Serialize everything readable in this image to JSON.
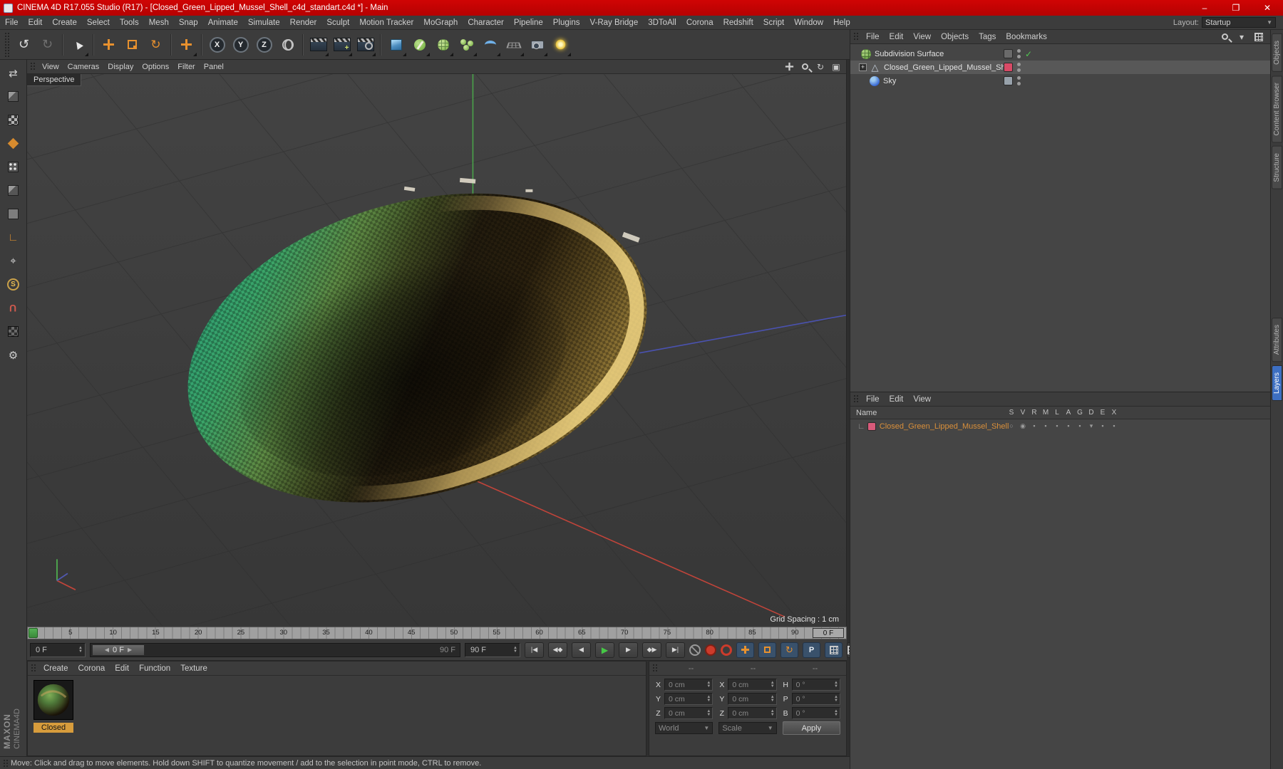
{
  "window": {
    "title": "CINEMA 4D R17.055 Studio (R17) - [Closed_Green_Lipped_Mussel_Shell_c4d_standart.c4d *] - Main",
    "min": "–",
    "max": "❐",
    "close": "✕"
  },
  "menu": {
    "items": [
      "File",
      "Edit",
      "Create",
      "Select",
      "Tools",
      "Mesh",
      "Snap",
      "Animate",
      "Simulate",
      "Render",
      "Sculpt",
      "Motion Tracker",
      "MoGraph",
      "Character",
      "Pipeline",
      "Plugins",
      "V-Ray Bridge",
      "3DToAll",
      "Corona",
      "Redshift",
      "Script",
      "Window",
      "Help"
    ],
    "layout_label": "Layout:",
    "layout_value": "Startup"
  },
  "toolbar": {
    "axis": [
      "X",
      "Y",
      "Z"
    ]
  },
  "vp": {
    "menu": [
      "View",
      "Cameras",
      "Display",
      "Options",
      "Filter",
      "Panel"
    ],
    "label": "Perspective",
    "grid": "Grid Spacing : 1 cm"
  },
  "tl": {
    "ticks": [
      "5",
      "10",
      "15",
      "20",
      "25",
      "30",
      "35",
      "40",
      "45",
      "50",
      "55",
      "60",
      "65",
      "70",
      "75",
      "80",
      "85",
      "90"
    ],
    "current": "0 F",
    "start": "0 F",
    "sval": "0 F",
    "send": "90 F",
    "end": "90 F",
    "tr": [
      "|◀",
      "◀◆",
      "◀",
      "▶",
      "▶",
      "◆▶",
      "▶|"
    ]
  },
  "mat": {
    "menu": [
      "Create",
      "Corona",
      "Edit",
      "Function",
      "Texture"
    ],
    "name": "Closed"
  },
  "co": {
    "h": [
      "--",
      "--",
      "--"
    ],
    "xl": "X",
    "xv": "0 cm",
    "yl": "Y",
    "yv": "0 cm",
    "zl": "Z",
    "zv": "0 cm",
    "sxl": "X",
    "sxv": "0 cm",
    "syl": "Y",
    "syv": "0 cm",
    "szl": "Z",
    "szv": "0 cm",
    "hl": "H",
    "hv": "0 °",
    "pl": "P",
    "pv": "0 °",
    "bl": "B",
    "bv": "0 °",
    "world": "World",
    "scale": "Scale",
    "apply": "Apply"
  },
  "om": {
    "menu": [
      "File",
      "Edit",
      "View",
      "Objects",
      "Tags",
      "Bookmarks"
    ],
    "rows": [
      {
        "name": "Subdivision Surface"
      },
      {
        "name": "Closed_Green_Lipped_Mussel_Shell"
      },
      {
        "name": "Sky"
      }
    ]
  },
  "lm": {
    "menu": [
      "File",
      "Edit",
      "View"
    ],
    "name_header": "Name",
    "cols": [
      "S",
      "V",
      "R",
      "M",
      "L",
      "A",
      "G",
      "D",
      "E",
      "X"
    ],
    "rows": [
      {
        "name": "Closed_Green_Lipped_Mussel_Shell"
      }
    ]
  },
  "tabs": {
    "top": [
      "Objects",
      "Content Browser",
      "Structure"
    ],
    "bottom": [
      "Attributes",
      "Layers"
    ]
  },
  "status": "Move: Click and drag to move elements. Hold down SHIFT to quantize movement / add to the selection in point mode, CTRL to remove.",
  "brand": {
    "a": "MAXON",
    "b": "CINEMA4D"
  },
  "colors": {
    "accent_orange": "#e8912e",
    "title_red": "#c40404",
    "selection_blue": "#3d6fc2",
    "material_tag_pink": "#d85a7a",
    "play_green": "#46c846"
  }
}
